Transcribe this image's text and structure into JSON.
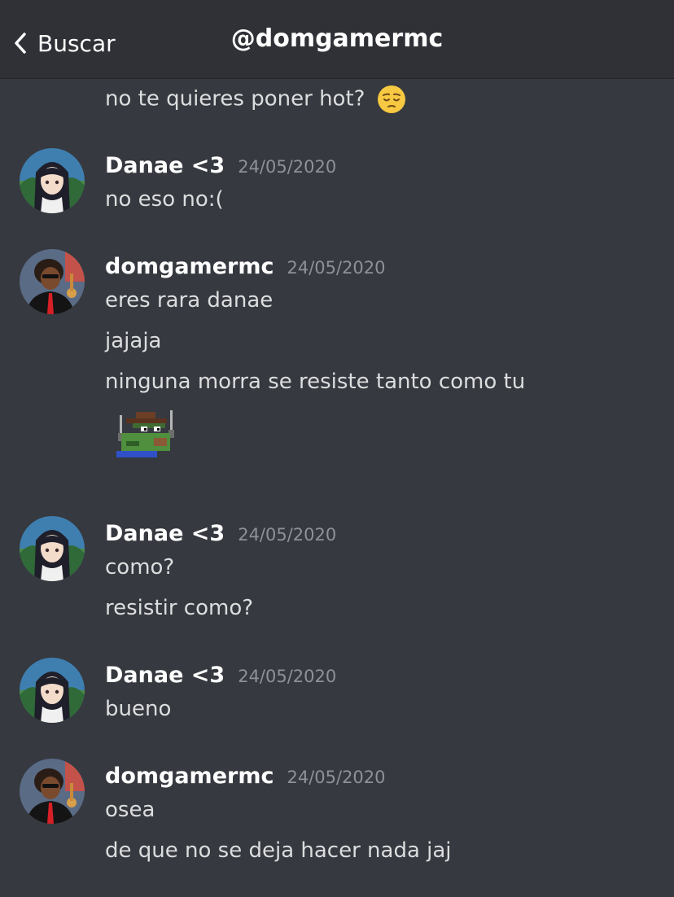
{
  "header": {
    "back_label": "Buscar",
    "title": "@domgamermc"
  },
  "messages": {
    "m0": {
      "text": "no te quieres poner hot?",
      "emoji": "pensive-face-emoji"
    },
    "g1": {
      "author": "Danae <3",
      "timestamp": "24/05/2020",
      "lines": [
        "no eso no:("
      ]
    },
    "g2": {
      "author": "domgamermc",
      "timestamp": "24/05/2020",
      "lines": [
        "eres rara danae",
        "jajaja",
        "ninguna morra se resiste tanto como tu"
      ],
      "sticker": "pixel-frog-cowboy-sticker"
    },
    "g3": {
      "author": "Danae <3",
      "timestamp": "24/05/2020",
      "lines": [
        "como?",
        "resistir como?"
      ]
    },
    "g4": {
      "author": "Danae <3",
      "timestamp": "24/05/2020",
      "lines": [
        "bueno"
      ]
    },
    "g5": {
      "author": "domgamermc",
      "timestamp": "24/05/2020",
      "lines": [
        "osea",
        "de que no se deja hacer nada jaj"
      ]
    }
  },
  "colors": {
    "background": "#36393f",
    "header": "#2f3136",
    "text": "#dcddde",
    "username": "#ffffff",
    "timestamp": "#8e9297"
  }
}
